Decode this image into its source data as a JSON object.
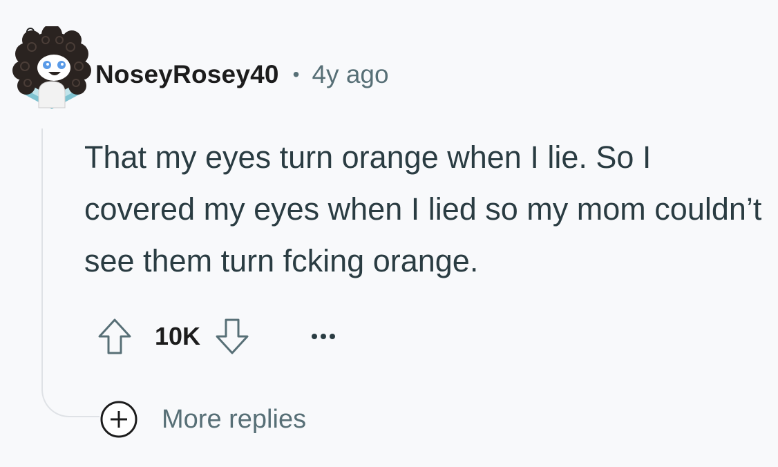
{
  "comment": {
    "author": "NoseyRosey40",
    "separator": "•",
    "timestamp": "4y ago",
    "body": "That my eyes turn orange when I lie. So I covered my eyes when I lied so my mom couldn’t see them turn fcking orange.",
    "score": "10K",
    "avatar_icon": "snoo-avatar-icon",
    "upvote_icon": "arrow-up-icon",
    "downvote_icon": "arrow-down-icon",
    "more_options_icon": "ellipsis-icon"
  },
  "more_replies": {
    "label": "More replies",
    "icon": "plus-circle-icon"
  },
  "colors": {
    "background": "#f8f9fb",
    "username": "#1c1c1c",
    "meta_text": "#576f76",
    "body_text": "#2a3c42",
    "thread_line": "#dfe2e6"
  }
}
